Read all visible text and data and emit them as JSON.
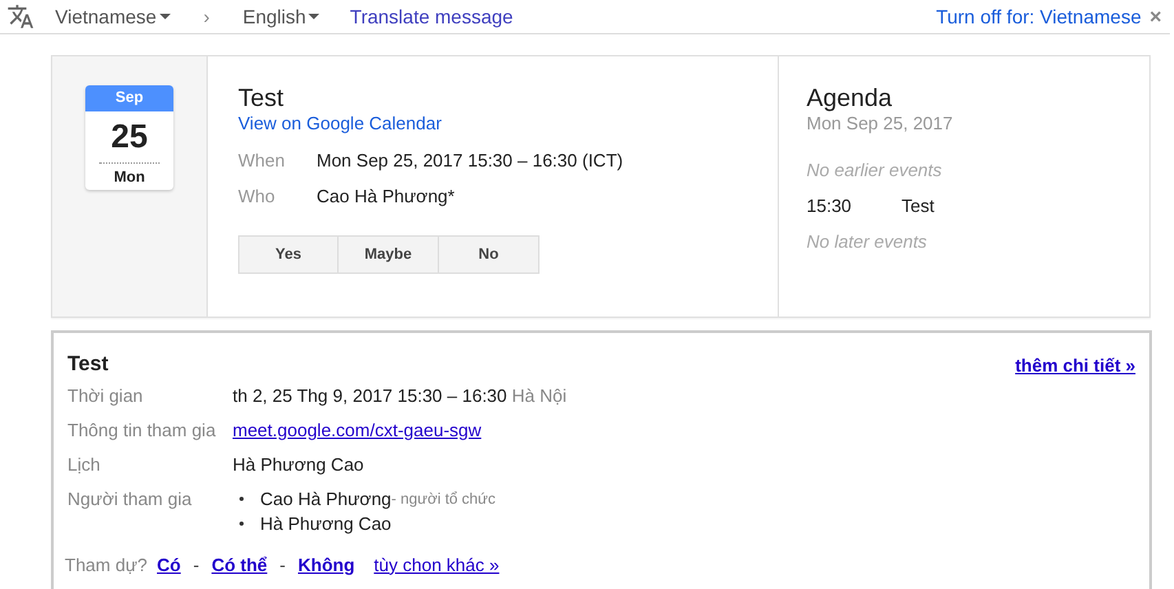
{
  "translate_bar": {
    "source_language": "Vietnamese",
    "separator": "›",
    "target_language": "English",
    "translate_link": "Translate message",
    "turn_off_link": "Turn off for: Vietnamese",
    "close": "×"
  },
  "invite_card": {
    "calendar_icon": {
      "month": "Sep",
      "day": "25",
      "weekday": "Mon"
    },
    "title": "Test",
    "calendar_link": "View on Google Calendar",
    "details": [
      {
        "label": "When",
        "value": "Mon Sep 25, 2017 15:30 – 16:30 (ICT)"
      },
      {
        "label": "Who",
        "value": "Cao Hà Phương*"
      }
    ],
    "rsvp_buttons": [
      "Yes",
      "Maybe",
      "No"
    ],
    "agenda": {
      "title": "Agenda",
      "date": "Mon Sep 25, 2017",
      "items": [
        {
          "kind": "note",
          "text": "No earlier events"
        },
        {
          "kind": "event",
          "time": "15:30",
          "text": "Test"
        },
        {
          "kind": "note",
          "text": "No later events"
        }
      ]
    }
  },
  "details_card": {
    "title": "Test",
    "more_link": "thêm chi tiết »",
    "rows": [
      {
        "kind": "text",
        "label": "Thời gian",
        "value": "th 2, 25 Thg 9, 2017 15:30 – 16:30",
        "suffix": "Hà Nội"
      },
      {
        "kind": "link",
        "label": "Thông tin tham gia",
        "value": "meet.google.com/cxt-gaeu-sgw"
      },
      {
        "kind": "text",
        "label": "Lịch",
        "value": "Hà Phương Cao"
      },
      {
        "kind": "list",
        "label": "Người tham gia",
        "items": [
          {
            "name": "Cao Hà Phương",
            "note": "- người tổ chức"
          },
          {
            "name": "Hà Phương Cao"
          }
        ]
      }
    ],
    "attend": {
      "label": "Tham dự?",
      "options": [
        "Có",
        "Có thể",
        "Không"
      ],
      "separator": "-",
      "more": "tùy chon khác »"
    }
  }
}
